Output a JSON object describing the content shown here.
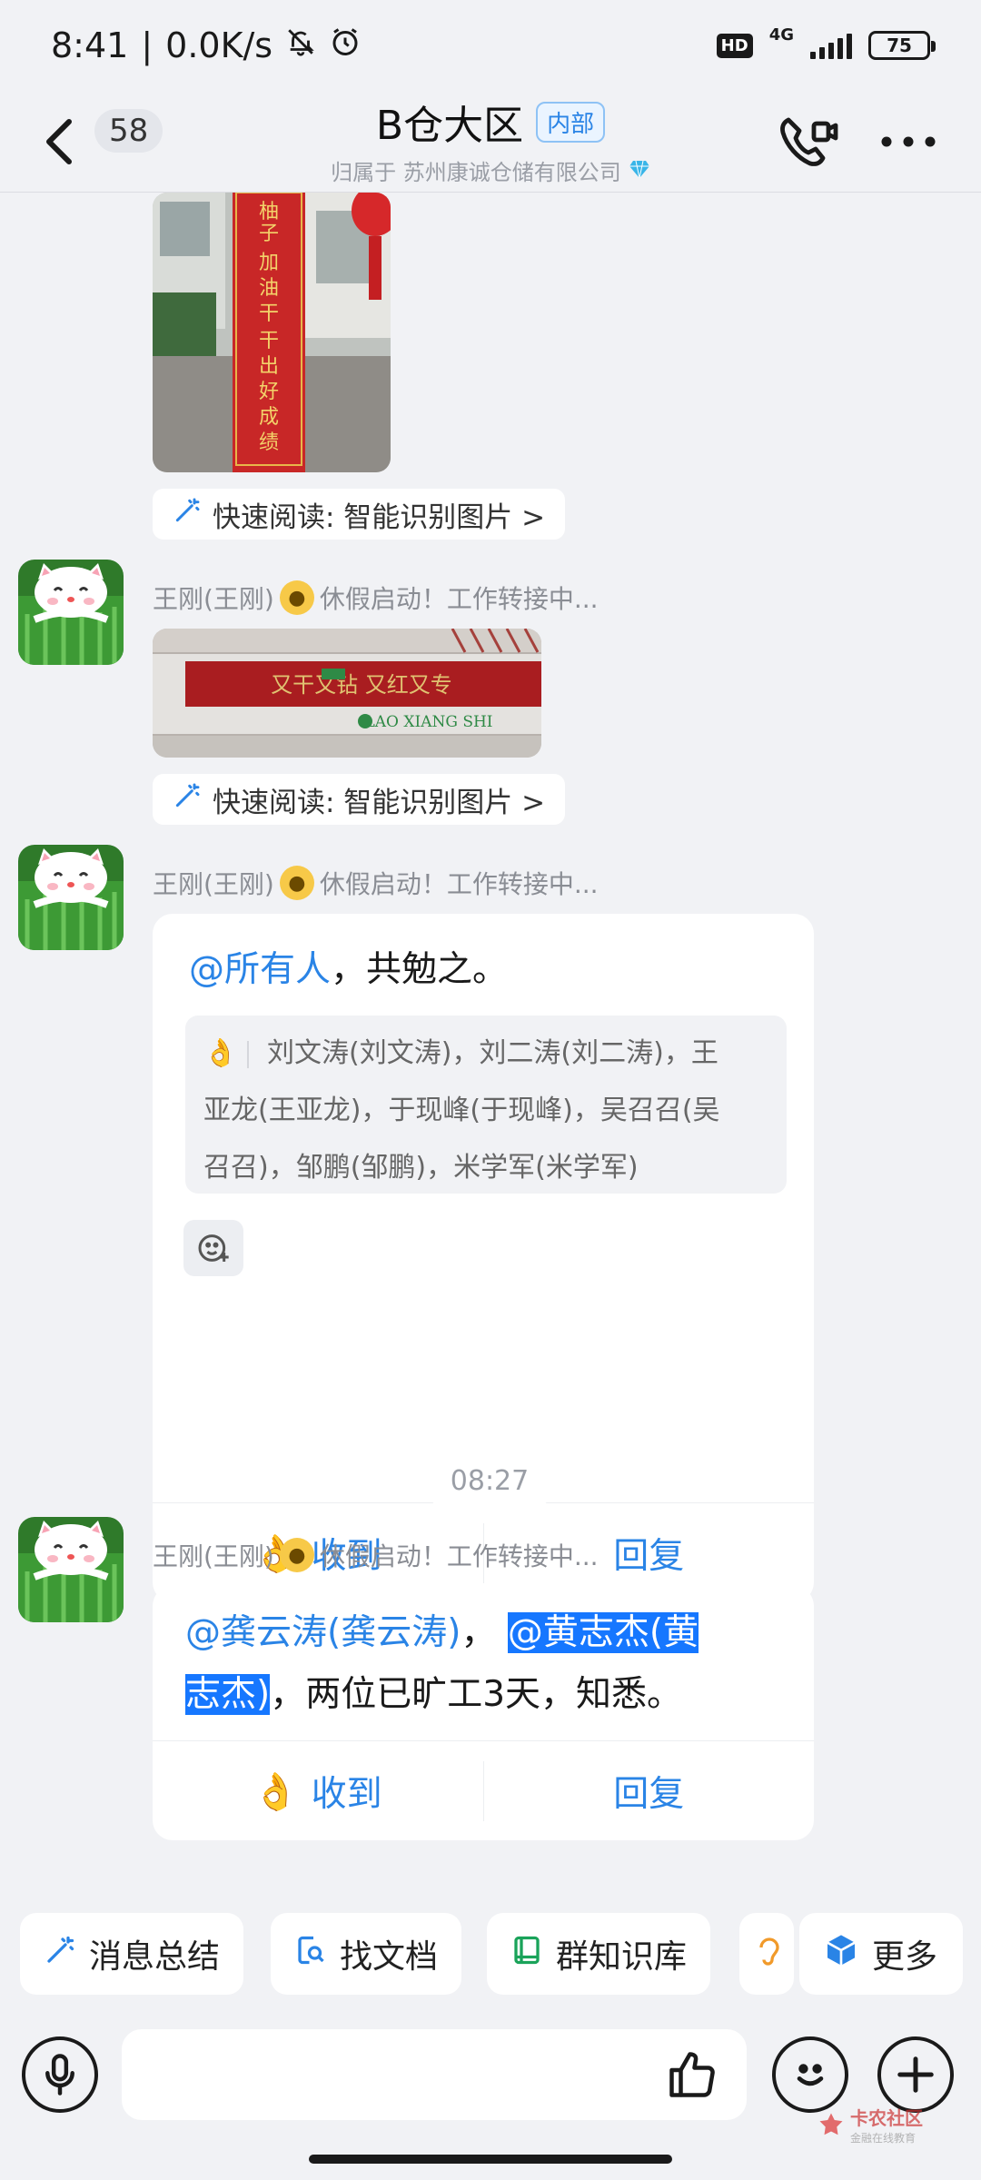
{
  "status_bar": {
    "time": "8:41",
    "net_speed": "0.0K/s",
    "hd": "HD",
    "network": "4G",
    "battery": "75"
  },
  "header": {
    "unread": "58",
    "title": "B仓大区",
    "tag": "内部",
    "subtitle": "归属于 苏州康诚仓储有限公司"
  },
  "messages": {
    "img1_lines": [
      "柚子加油干 干出好成绩"
    ],
    "quick_read_1": "快速阅读: 智能识别图片 >",
    "sender_2": "王刚(王刚)",
    "status_2": "休假启动！工作转接中...",
    "img2_text": "又干又钻 又红又专",
    "img2_brand": "LAO XIANG SHI",
    "quick_read_2": "快速阅读: 智能识别图片 >",
    "sender_3": "王刚(王刚)",
    "status_3": "休假启动！工作转接中...",
    "msg3_mention": "@所有人",
    "msg3_text": "，共勉之。",
    "msg3_receipts": "刘文涛(刘文涛)，刘二涛(刘二涛)，王亚龙(王亚龙)，于现峰(于现峰)，吴召召(吴召召)，邹鹏(邹鹏)，米学军(米学军)",
    "receipt_line1": "刘文涛(刘文涛)，刘二涛(刘二涛)，王",
    "receipt_line2": "亚龙(王亚龙)，于现峰(于现峰)，吴召召(吴",
    "receipt_line3": "召召)，邹鹏(邹鹏)，米学军(米学军)",
    "ack_label": "收到",
    "reply_label": "回复",
    "time_divider": "08:27",
    "sender_4": "王刚(王刚)",
    "status_4": "休假启动！工作转接中...",
    "msg4_mention1": "@龚云涛(龚云涛)",
    "msg4_sep": "，",
    "msg4_mention2_part1": "@黄志杰(黄",
    "msg4_mention2_part2": "志杰)",
    "msg4_text": "，两位已旷工3天，知悉。",
    "ack_label_2": "收到",
    "reply_label_2": "回复"
  },
  "shortcuts": [
    "消息总结",
    "找文档",
    "群知识库",
    "更多"
  ],
  "input": {
    "placeholder": ""
  },
  "watermark": {
    "main": "卡农社区",
    "sub": "金融在线教育"
  },
  "colors": {
    "accent": "#2a84e6",
    "highlight": "#1677ff",
    "background": "#f1f2f5"
  }
}
